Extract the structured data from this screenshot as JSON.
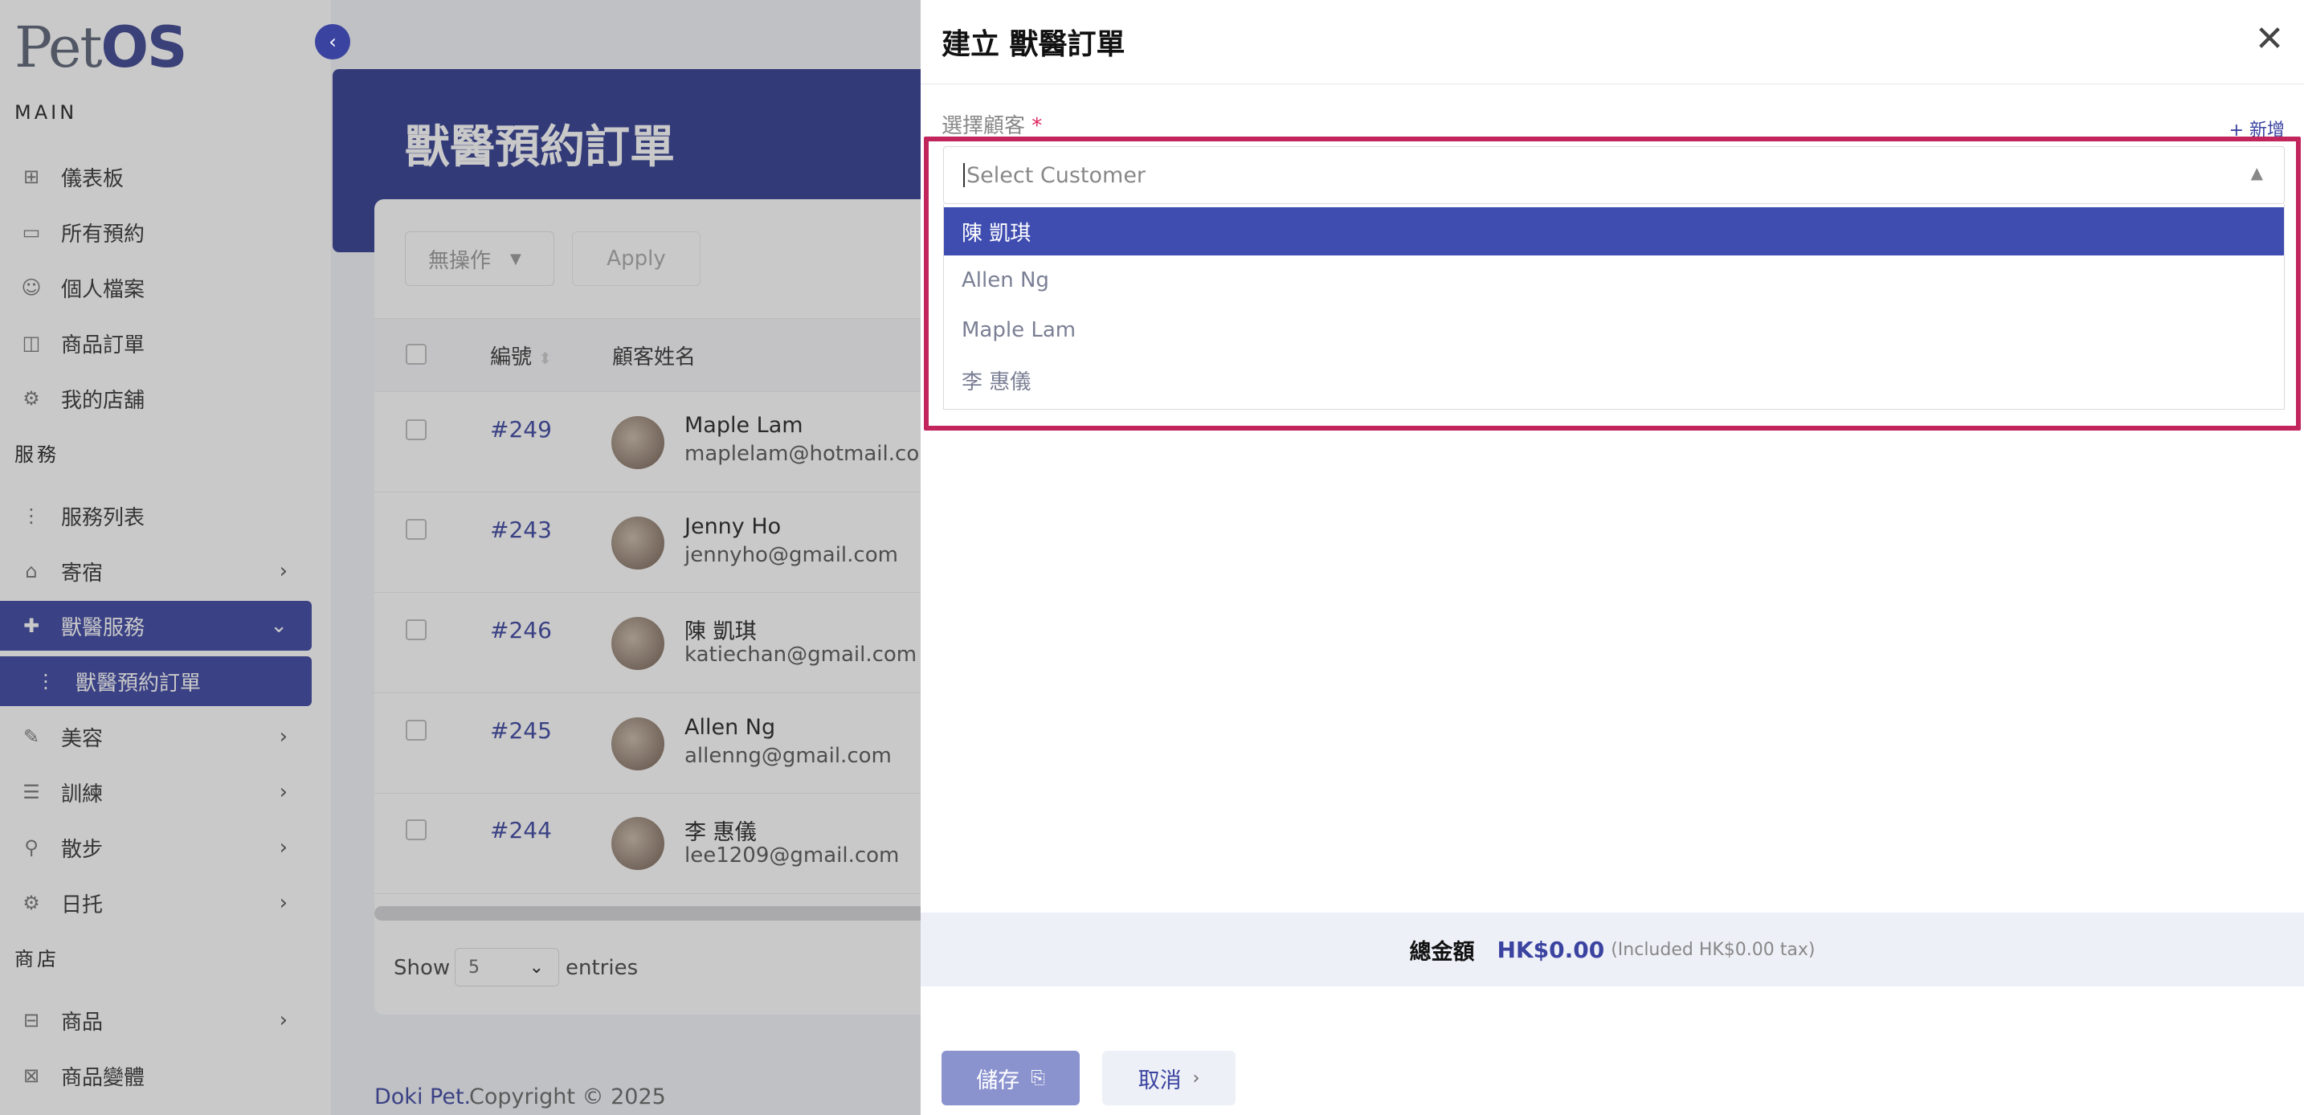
{
  "sidebar": {
    "logo_prefix": "Pet",
    "logo_suffix": "OS",
    "collapse_icon": "‹",
    "section_main": "MAIN",
    "section_services": "服務",
    "section_shop": "商店",
    "items": {
      "dashboard": "儀表板",
      "all_bookings": "所有預約",
      "profile": "個人檔案",
      "product_orders": "商品訂單",
      "my_store": "我的店舖",
      "service_list": "服務列表",
      "boarding": "寄宿",
      "vet_services": "獸醫服務",
      "vet_orders": "獸醫預約訂單",
      "grooming": "美容",
      "training": "訓練",
      "walking": "散步",
      "daycare": "日托",
      "products": "商品",
      "product_variants": "商品變體"
    }
  },
  "page": {
    "title": "獸醫預約訂單",
    "bulk_action": "無操作",
    "apply": "Apply",
    "col_id": "編號",
    "col_name": "顧客姓名",
    "rows": [
      {
        "id": "#249",
        "name": "Maple Lam",
        "email": "maplelam@hotmail.com"
      },
      {
        "id": "#243",
        "name": "Jenny Ho",
        "email": "jennyho@gmail.com"
      },
      {
        "id": "#246",
        "name": "陳 凱琪",
        "email": "katiechan@gmail.com"
      },
      {
        "id": "#245",
        "name": "Allen Ng",
        "email": "allenng@gmail.com"
      },
      {
        "id": "#244",
        "name": "李 惠儀",
        "email": "lee1209@gmail.com"
      }
    ],
    "show_label": "Show",
    "show_value": "5",
    "entries_label": "entries",
    "footer_brand": "Doki Pet.",
    "footer_copy": "Copyright © 2025"
  },
  "drawer": {
    "title": "建立 獸醫訂單",
    "close_icon": "✕",
    "customer_label": "選擇顧客",
    "required_mark": "*",
    "add_new": "+ 新增",
    "customer_placeholder": "Select Customer",
    "options": [
      "陳 凱琪",
      "Allen Ng",
      "Maple Lam",
      "李 惠儀"
    ],
    "selected_index": 0,
    "total_label": "總金額",
    "total_value": "HK$0.00",
    "total_tax": "(Included HK$0.00 tax)",
    "save": "儲存",
    "cancel": "取消"
  },
  "colors": {
    "primary": "#3a43a0",
    "highlight": "#c2255c",
    "selected_option": "#3f4db0"
  }
}
